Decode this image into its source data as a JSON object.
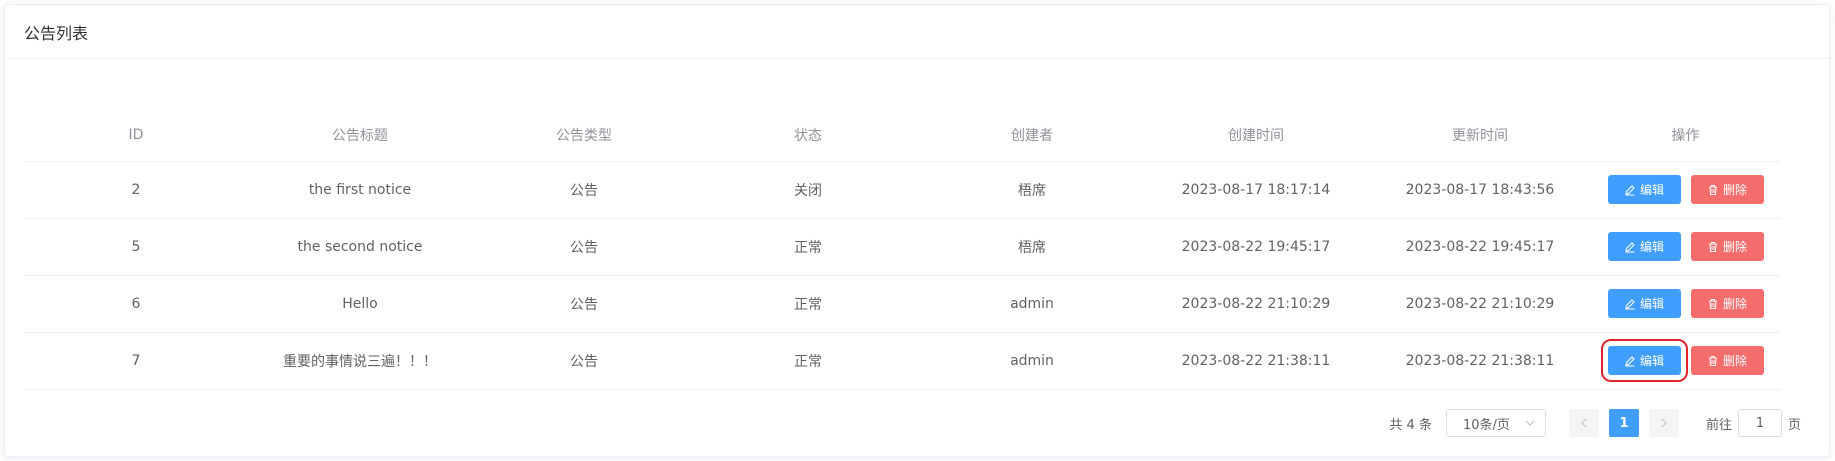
{
  "card": {
    "title": "公告列表"
  },
  "table": {
    "columns": [
      "ID",
      "公告标题",
      "公告类型",
      "状态",
      "创建者",
      "创建时间",
      "更新时间",
      "操作"
    ],
    "rows": [
      {
        "id": "2",
        "title": "the first notice",
        "type": "公告",
        "status": "关闭",
        "creator": "梧席",
        "created": "2023-08-17 18:17:14",
        "updated": "2023-08-17 18:43:56"
      },
      {
        "id": "5",
        "title": "the second notice",
        "type": "公告",
        "status": "正常",
        "creator": "梧席",
        "created": "2023-08-22 19:45:17",
        "updated": "2023-08-22 19:45:17"
      },
      {
        "id": "6",
        "title": "Hello",
        "type": "公告",
        "status": "正常",
        "creator": "admin",
        "created": "2023-08-22 21:10:29",
        "updated": "2023-08-22 21:10:29"
      },
      {
        "id": "7",
        "title": "重要的事情说三遍！！！",
        "type": "公告",
        "status": "正常",
        "creator": "admin",
        "created": "2023-08-22 21:38:11",
        "updated": "2023-08-22 21:38:11"
      }
    ],
    "edit_label": "编辑",
    "delete_label": "删除"
  },
  "pagination": {
    "total_text": "共 4 条",
    "page_size": "10条/页",
    "current_page": "1",
    "goto_label": "前往",
    "goto_value": "1",
    "page_suffix": "页"
  },
  "colors": {
    "primary": "#409eff",
    "danger": "#f56c6c",
    "highlight": "#e0242b"
  }
}
